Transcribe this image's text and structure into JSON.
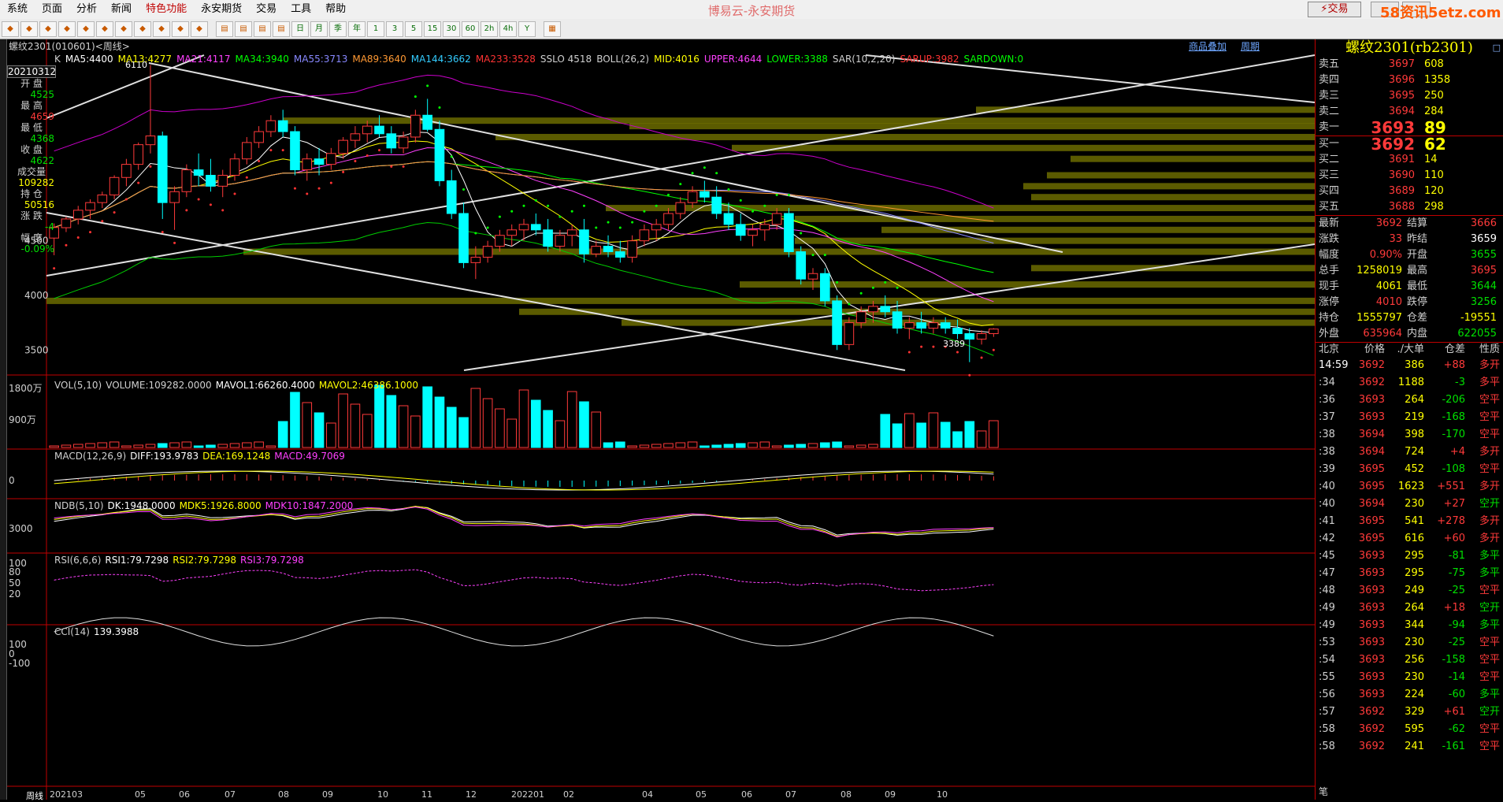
{
  "app": {
    "title": "博易云-永安期货",
    "trade_button": "⚡交易",
    "window_controls": [
      "",
      ""
    ],
    "watermark": "58资讯5etz.com"
  },
  "menu": [
    "系统",
    "页面",
    "分析",
    "新闻",
    "特色功能",
    "永安期货",
    "交易",
    "工具",
    "帮助"
  ],
  "menu_highlight": "特色功能",
  "toolbar": {
    "period_buttons": [
      "日",
      "月",
      "季",
      "年",
      "1",
      "3",
      "5",
      "15",
      "30",
      "60",
      "2h",
      "4h",
      "Y"
    ]
  },
  "chart": {
    "symbol_header": "螺纹2301(010601)<周线>",
    "top_links": [
      "商品叠加",
      "周期"
    ],
    "indicators": [
      {
        "text": "K",
        "color": "#d0d0d0"
      },
      {
        "text": "MA5:4400",
        "color": "#ffffff"
      },
      {
        "text": "MA13:4277",
        "color": "#ffff00"
      },
      {
        "text": "MA21:4117",
        "color": "#ff40ff"
      },
      {
        "text": "MA34:3940",
        "color": "#00ff00"
      },
      {
        "text": "MA55:3713",
        "color": "#8888ff"
      },
      {
        "text": "MA89:3640",
        "color": "#ff9933"
      },
      {
        "text": "MA144:3662",
        "color": "#33ccff"
      },
      {
        "text": "MA233:3528",
        "color": "#ff3333"
      },
      {
        "text": "SSLO 4518",
        "color": "#d0d0d0"
      },
      {
        "text": "BOLL(26,2)",
        "color": "#d0d0d0"
      },
      {
        "text": "MID:4016",
        "color": "#ffff00"
      },
      {
        "text": "UPPER:4644",
        "color": "#ff40ff"
      },
      {
        "text": "LOWER:3388",
        "color": "#00ff00"
      },
      {
        "text": "SAR(10,2,20)",
        "color": "#d0d0d0"
      },
      {
        "text": "SARUP:3982",
        "color": "#ff3333"
      },
      {
        "text": "SARDOWN:0",
        "color": "#00ff00"
      }
    ],
    "infobox": {
      "date": "20210312",
      "rows": [
        {
          "label": "开 盘",
          "value": "4525",
          "color": "#00e000"
        },
        {
          "label": "最 高",
          "value": "4659",
          "color": "#ff3a3a"
        },
        {
          "label": "最 低",
          "value": "4368",
          "color": "#00e000"
        },
        {
          "label": "收 盘",
          "value": "4622",
          "color": "#00e000"
        },
        {
          "label": "成交量",
          "value": "109282",
          "color": "#ffff00"
        },
        {
          "label": "持 仓",
          "value": "50516",
          "color": "#ffff00"
        },
        {
          "label": "涨 跌",
          "value": "-4",
          "color": "#00e000"
        },
        {
          "label": "幅 度",
          "value": "-0.09%",
          "color": "#00e000"
        }
      ]
    },
    "y_main": [
      "4500",
      "4000",
      "3500"
    ],
    "annotations": {
      "high": "6110",
      "low": "3389"
    },
    "vol": {
      "header": [
        {
          "text": "VOL(5,10)",
          "color": "#d0d0d0"
        },
        {
          "text": "VOLUME:109282.0000",
          "color": "#d0d0d0"
        },
        {
          "text": "MAVOL1:66260.4000",
          "color": "#ffffff"
        },
        {
          "text": "MAVOL2:46386.1000",
          "color": "#ffff00"
        }
      ],
      "y": [
        "1800万",
        "900万"
      ]
    },
    "macd": {
      "header": [
        {
          "text": "MACD(12,26,9)",
          "color": "#d0d0d0"
        },
        {
          "text": "DIFF:193.9783",
          "color": "#ffffff"
        },
        {
          "text": "DEA:169.1248",
          "color": "#ffff00"
        },
        {
          "text": "MACD:49.7069",
          "color": "#ff40ff"
        }
      ],
      "y": [
        "0"
      ]
    },
    "ndb": {
      "header": [
        {
          "text": "NDB(5,10)",
          "color": "#d0d0d0"
        },
        {
          "text": "DK:1948.0000",
          "color": "#ffffff"
        },
        {
          "text": "MDK5:1926.8000",
          "color": "#ffff00"
        },
        {
          "text": "MDK10:1847.2000",
          "color": "#ff40ff"
        }
      ],
      "y": [
        "3000"
      ]
    },
    "rsi": {
      "header": [
        {
          "text": "RSI(6,6,6)",
          "color": "#d0d0d0"
        },
        {
          "text": "RSI1:79.7298",
          "color": "#ffffff"
        },
        {
          "text": "RSI2:79.7298",
          "color": "#ffff00"
        },
        {
          "text": "RSI3:79.7298",
          "color": "#ff40ff"
        }
      ],
      "y": [
        "100",
        "80",
        "50",
        "20"
      ]
    },
    "cci": {
      "header": [
        {
          "text": "CCI(14)",
          "color": "#d0d0d0"
        },
        {
          "text": "139.3988",
          "color": "#ffffff"
        }
      ],
      "y": [
        "100",
        "0",
        "-100"
      ]
    },
    "period_label": "周线",
    "x_labels": [
      "202103",
      "05",
      "06",
      "07",
      "08",
      "09",
      "10",
      "11",
      "12",
      "202201",
      "02",
      "04",
      "05",
      "06",
      "07",
      "08",
      "09",
      "10"
    ]
  },
  "quote": {
    "title": "螺纹2301(rb2301)",
    "asks": [
      {
        "label": "卖五",
        "price": "3697",
        "vol": "608"
      },
      {
        "label": "卖四",
        "price": "3696",
        "vol": "1358"
      },
      {
        "label": "卖三",
        "price": "3695",
        "vol": "250"
      },
      {
        "label": "卖二",
        "price": "3694",
        "vol": "284"
      },
      {
        "label": "卖一",
        "price": "3693",
        "vol": "89"
      }
    ],
    "bids": [
      {
        "label": "买一",
        "price": "3692",
        "vol": "62"
      },
      {
        "label": "买二",
        "price": "3691",
        "vol": "14"
      },
      {
        "label": "买三",
        "price": "3690",
        "vol": "110"
      },
      {
        "label": "买四",
        "price": "3689",
        "vol": "120"
      },
      {
        "label": "买五",
        "price": "3688",
        "vol": "298"
      }
    ],
    "stats": [
      {
        "l1": "最新",
        "v1": "3692",
        "c1": "red",
        "l2": "结算",
        "v2": "3666",
        "c2": "red"
      },
      {
        "l1": "涨跌",
        "v1": "33",
        "c1": "red",
        "l2": "昨结",
        "v2": "3659",
        "c2": "wht"
      },
      {
        "l1": "幅度",
        "v1": "0.90%",
        "c1": "red",
        "l2": "开盘",
        "v2": "3655",
        "c2": "grn"
      },
      {
        "l1": "总手",
        "v1": "1258019",
        "c1": "yel",
        "l2": "最高",
        "v2": "3695",
        "c2": "red"
      },
      {
        "l1": "现手",
        "v1": "4061",
        "c1": "yel",
        "l2": "最低",
        "v2": "3644",
        "c2": "grn"
      },
      {
        "l1": "涨停",
        "v1": "4010",
        "c1": "red",
        "l2": "跌停",
        "v2": "3256",
        "c2": "grn"
      },
      {
        "l1": "持仓",
        "v1": "1555797",
        "c1": "yel",
        "l2": "仓差",
        "v2": "-19551",
        "c2": "yel"
      },
      {
        "l1": "外盘",
        "v1": "635964",
        "c1": "red",
        "l2": "内盘",
        "v2": "622055",
        "c2": "grn"
      }
    ],
    "tick_header": [
      "北京",
      "价格",
      "./大单",
      "仓差",
      "性质"
    ],
    "ticks": [
      {
        "t": "14:59",
        "p": "3692",
        "v": "386",
        "o": "+88",
        "n": "多开",
        "c": "red"
      },
      {
        "t": ":34",
        "p": "3692",
        "v": "1188",
        "o": "-3",
        "n": "多平",
        "c": "red"
      },
      {
        "t": ":36",
        "p": "3693",
        "v": "264",
        "o": "-206",
        "n": "空平",
        "c": "red"
      },
      {
        "t": ":37",
        "p": "3693",
        "v": "219",
        "o": "-168",
        "n": "空平",
        "c": "red"
      },
      {
        "t": ":38",
        "p": "3694",
        "v": "398",
        "o": "-170",
        "n": "空平",
        "c": "red"
      },
      {
        "t": ":38",
        "p": "3694",
        "v": "724",
        "o": "+4",
        "n": "多开",
        "c": "red"
      },
      {
        "t": ":39",
        "p": "3695",
        "v": "452",
        "o": "-108",
        "n": "空平",
        "c": "red"
      },
      {
        "t": ":40",
        "p": "3695",
        "v": "1623",
        "o": "+551",
        "n": "多开",
        "c": "red"
      },
      {
        "t": ":40",
        "p": "3694",
        "v": "230",
        "o": "+27",
        "n": "空开",
        "c": "grn"
      },
      {
        "t": ":41",
        "p": "3695",
        "v": "541",
        "o": "+278",
        "n": "多开",
        "c": "red"
      },
      {
        "t": ":42",
        "p": "3695",
        "v": "616",
        "o": "+60",
        "n": "多开",
        "c": "red"
      },
      {
        "t": ":45",
        "p": "3693",
        "v": "295",
        "o": "-81",
        "n": "多平",
        "c": "grn"
      },
      {
        "t": ":47",
        "p": "3693",
        "v": "295",
        "o": "-75",
        "n": "多平",
        "c": "grn"
      },
      {
        "t": ":48",
        "p": "3693",
        "v": "249",
        "o": "-25",
        "n": "空平",
        "c": "red"
      },
      {
        "t": ":49",
        "p": "3693",
        "v": "264",
        "o": "+18",
        "n": "空开",
        "c": "grn"
      },
      {
        "t": ":49",
        "p": "3693",
        "v": "344",
        "o": "-94",
        "n": "多平",
        "c": "grn"
      },
      {
        "t": ":53",
        "p": "3693",
        "v": "230",
        "o": "-25",
        "n": "空平",
        "c": "red"
      },
      {
        "t": ":54",
        "p": "3693",
        "v": "256",
        "o": "-158",
        "n": "空平",
        "c": "red"
      },
      {
        "t": ":55",
        "p": "3693",
        "v": "230",
        "o": "-14",
        "n": "空平",
        "c": "red"
      },
      {
        "t": ":56",
        "p": "3693",
        "v": "224",
        "o": "-60",
        "n": "多平",
        "c": "grn"
      },
      {
        "t": ":57",
        "p": "3692",
        "v": "329",
        "o": "+61",
        "n": "空开",
        "c": "grn"
      },
      {
        "t": ":58",
        "p": "3692",
        "v": "595",
        "o": "-62",
        "n": "空平",
        "c": "red"
      },
      {
        "t": ":58",
        "p": "3692",
        "v": "241",
        "o": "-161",
        "n": "空平",
        "c": "red"
      }
    ],
    "footer": "笔"
  },
  "chart_data": {
    "type": "candlestick",
    "categories": [
      "202103",
      "",
      "",
      "",
      "",
      "",
      "",
      "",
      "05",
      "",
      "",
      "",
      "06",
      "",
      "",
      "",
      "",
      "07",
      "",
      "",
      "",
      "08",
      "",
      "",
      "",
      "",
      "09",
      "",
      "",
      "",
      "10",
      "",
      "",
      "",
      "11",
      "",
      "",
      "",
      "12",
      "",
      "",
      "",
      "",
      "202201",
      "",
      "",
      "",
      "02",
      "",
      "",
      "",
      "",
      "",
      "",
      "",
      "04",
      "",
      "",
      "",
      "05",
      "",
      "",
      "",
      "06",
      "",
      "",
      "",
      "",
      "07",
      "",
      "",
      "",
      "08",
      "",
      "",
      "",
      "",
      "09",
      "",
      "",
      "",
      "10",
      "",
      "",
      "",
      ""
    ],
    "ohlc": [
      [
        4525,
        4659,
        4368,
        4622
      ],
      [
        4620,
        4720,
        4580,
        4700
      ],
      [
        4700,
        4820,
        4650,
        4780
      ],
      [
        4780,
        4880,
        4700,
        4850
      ],
      [
        4850,
        4950,
        4800,
        4920
      ],
      [
        4920,
        5100,
        4880,
        5080
      ],
      [
        5080,
        5250,
        5000,
        5200
      ],
      [
        5200,
        5400,
        5150,
        5380
      ],
      [
        5380,
        6110,
        5300,
        5460
      ],
      [
        5460,
        5500,
        4700,
        4850
      ],
      [
        4850,
        5000,
        4600,
        4950
      ],
      [
        4950,
        5200,
        4900,
        5150
      ],
      [
        5150,
        5300,
        5000,
        5100
      ],
      [
        5100,
        5250,
        4950,
        5000
      ],
      [
        5000,
        5150,
        4900,
        5100
      ],
      [
        5100,
        5300,
        5050,
        5250
      ],
      [
        5250,
        5450,
        5200,
        5400
      ],
      [
        5400,
        5550,
        5350,
        5500
      ],
      [
        5500,
        5650,
        5450,
        5600
      ],
      [
        5600,
        5700,
        5450,
        5500
      ],
      [
        5500,
        5550,
        5100,
        5150
      ],
      [
        5150,
        5300,
        5050,
        5250
      ],
      [
        5250,
        5350,
        5100,
        5200
      ],
      [
        5200,
        5350,
        5150,
        5300
      ],
      [
        5300,
        5450,
        5250,
        5420
      ],
      [
        5420,
        5550,
        5350,
        5480
      ],
      [
        5480,
        5600,
        5400,
        5550
      ],
      [
        5550,
        5650,
        5450,
        5480
      ],
      [
        5480,
        5550,
        5300,
        5350
      ],
      [
        5350,
        5500,
        5300,
        5450
      ],
      [
        5450,
        5700,
        5400,
        5650
      ],
      [
        5650,
        5800,
        5500,
        5520
      ],
      [
        5520,
        5600,
        5000,
        5050
      ],
      [
        5050,
        5150,
        4700,
        4750
      ],
      [
        4750,
        4850,
        4250,
        4300
      ],
      [
        4300,
        4450,
        4150,
        4350
      ],
      [
        4350,
        4500,
        4300,
        4450
      ],
      [
        4450,
        4600,
        4400,
        4550
      ],
      [
        4550,
        4650,
        4450,
        4600
      ],
      [
        4600,
        4700,
        4500,
        4650
      ],
      [
        4650,
        4750,
        4550,
        4600
      ],
      [
        4600,
        4700,
        4400,
        4450
      ],
      [
        4450,
        4600,
        4400,
        4550
      ],
      [
        4550,
        4650,
        4450,
        4600
      ],
      [
        4600,
        4700,
        4300,
        4380
      ],
      [
        4380,
        4500,
        4350,
        4450
      ],
      [
        4450,
        4550,
        4350,
        4400
      ],
      [
        4400,
        4500,
        4300,
        4350
      ],
      [
        4350,
        4550,
        4300,
        4500
      ],
      [
        4500,
        4650,
        4450,
        4600
      ],
      [
        4600,
        4700,
        4500,
        4650
      ],
      [
        4650,
        4800,
        4600,
        4750
      ],
      [
        4750,
        4900,
        4700,
        4850
      ],
      [
        4850,
        5000,
        4800,
        4950
      ],
      [
        4950,
        5050,
        4850,
        4900
      ],
      [
        4900,
        5000,
        4700,
        4750
      ],
      [
        4750,
        4850,
        4600,
        4650
      ],
      [
        4650,
        4750,
        4500,
        4550
      ],
      [
        4550,
        4650,
        4450,
        4600
      ],
      [
        4600,
        4700,
        4500,
        4650
      ],
      [
        4650,
        4800,
        4600,
        4750
      ],
      [
        4750,
        4800,
        4350,
        4400
      ],
      [
        4400,
        4450,
        4100,
        4150
      ],
      [
        4150,
        4250,
        4050,
        4200
      ],
      [
        4200,
        4250,
        3900,
        3950
      ],
      [
        3950,
        4000,
        3500,
        3550
      ],
      [
        3550,
        3800,
        3500,
        3750
      ],
      [
        3750,
        3900,
        3700,
        3850
      ],
      [
        3850,
        3950,
        3750,
        3900
      ],
      [
        3900,
        4000,
        3800,
        3850
      ],
      [
        3850,
        3950,
        3650,
        3700
      ],
      [
        3700,
        3800,
        3600,
        3750
      ],
      [
        3750,
        3850,
        3650,
        3700
      ],
      [
        3700,
        3800,
        3650,
        3750
      ],
      [
        3750,
        3800,
        3650,
        3700
      ],
      [
        3700,
        3780,
        3600,
        3650
      ],
      [
        3650,
        3700,
        3389,
        3600
      ],
      [
        3600,
        3680,
        3550,
        3650
      ],
      [
        3650,
        3700,
        3620,
        3692
      ]
    ],
    "ylim": [
      3300,
      6200
    ]
  }
}
